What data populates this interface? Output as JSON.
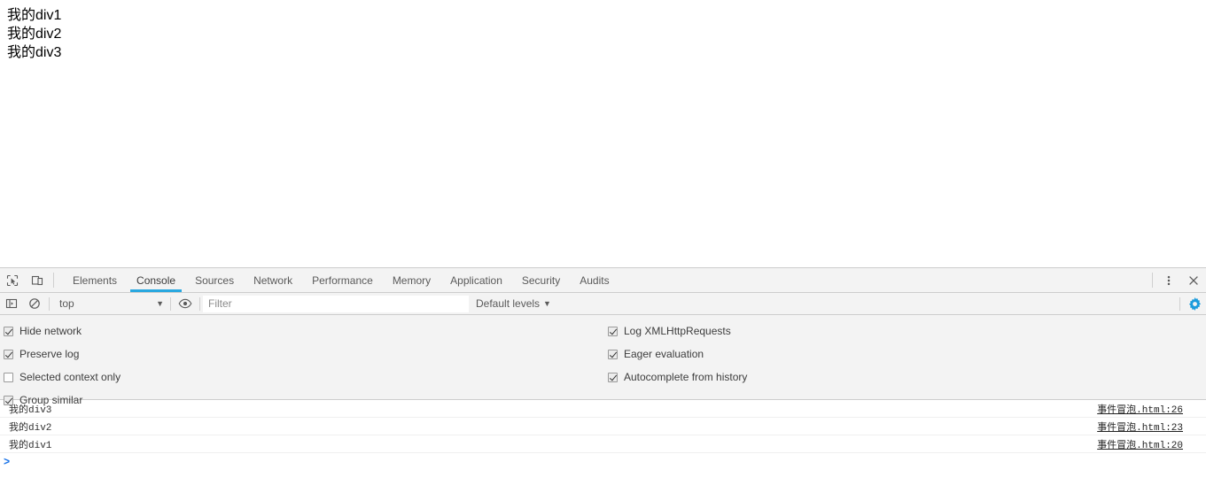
{
  "page": {
    "divs": [
      {
        "text": "我的div1"
      },
      {
        "text": "我的div2"
      },
      {
        "text": "我的div3"
      }
    ]
  },
  "devtools": {
    "toolbar": {
      "inspect_icon": "inspect-element-icon",
      "device_icon": "device-toolbar-icon",
      "more_icon": "more-options-icon",
      "close_icon": "close-icon",
      "tabs": [
        {
          "label": "Elements",
          "selected": false
        },
        {
          "label": "Console",
          "selected": true
        },
        {
          "label": "Sources",
          "selected": false
        },
        {
          "label": "Network",
          "selected": false
        },
        {
          "label": "Performance",
          "selected": false
        },
        {
          "label": "Memory",
          "selected": false
        },
        {
          "label": "Application",
          "selected": false
        },
        {
          "label": "Security",
          "selected": false
        },
        {
          "label": "Audits",
          "selected": false
        }
      ],
      "selected_tab_accent": "#29a8e0"
    },
    "console_toolbar": {
      "sidebar_icon": "console-sidebar-icon",
      "clear_icon": "clear-console-icon",
      "context": "top",
      "context_caret": "▼",
      "eye_icon": "create-live-expression-icon",
      "filter_placeholder": "Filter",
      "filter_value": "",
      "levels": "Default levels",
      "levels_caret": "▼",
      "settings_icon": "settings-gear-icon",
      "settings_icon_color": "#1a9bdc"
    },
    "settings": {
      "left": [
        {
          "label": "Hide network",
          "checked": true
        },
        {
          "label": "Preserve log",
          "checked": true
        },
        {
          "label": "Selected context only",
          "checked": false
        },
        {
          "label": "Group similar",
          "checked": true
        }
      ],
      "right": [
        {
          "label": "Log XMLHttpRequests",
          "checked": true
        },
        {
          "label": "Eager evaluation",
          "checked": true
        },
        {
          "label": "Autocomplete from history",
          "checked": true
        }
      ]
    },
    "messages": [
      {
        "text": "我的div3",
        "source": "事件冒泡.html:26"
      },
      {
        "text": "我的div2",
        "source": "事件冒泡.html:23"
      },
      {
        "text": "我的div1",
        "source": "事件冒泡.html:20"
      }
    ],
    "prompt": ">"
  }
}
